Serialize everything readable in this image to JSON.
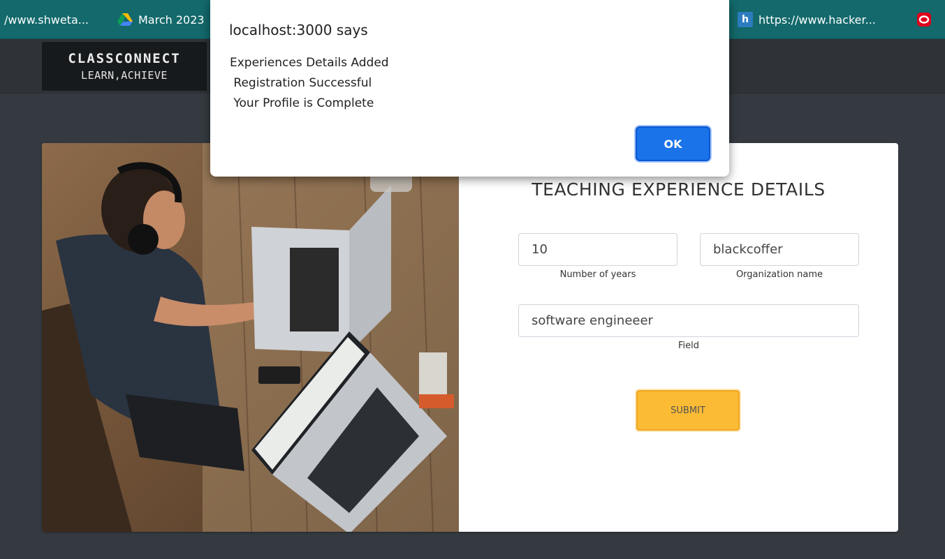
{
  "bookmarks": [
    {
      "label": "/www.shweta...",
      "icon": "bookmark-site"
    },
    {
      "label": "March 2023",
      "icon": "google-drive-icon"
    },
    {
      "label": "https://www.hacker...",
      "icon": "hackerrank-icon"
    },
    {
      "label": "",
      "icon": "opera-icon"
    }
  ],
  "brand": {
    "title": "CLASSCONNECT",
    "tagline": "LEARN,ACHIEVE"
  },
  "dialog": {
    "title": "localhost:3000 says",
    "message": "Experiences Details Added\n Registration Successful\n Your Profile is Complete",
    "ok_label": "OK"
  },
  "form": {
    "title": "TEACHING EXPERIENCE DETAILS",
    "years": {
      "value": "10",
      "label": "Number of years"
    },
    "organization": {
      "value": "blackcoffer",
      "label": "Organization name"
    },
    "field": {
      "value": "software engineeer",
      "label": "Field"
    },
    "submit_label": "SUBMIT"
  },
  "colors": {
    "bookmarks_bar": "#13696b",
    "page_background": "#343a40",
    "submit_button": "#fbbb34",
    "ok_button": "#1a73e8"
  }
}
